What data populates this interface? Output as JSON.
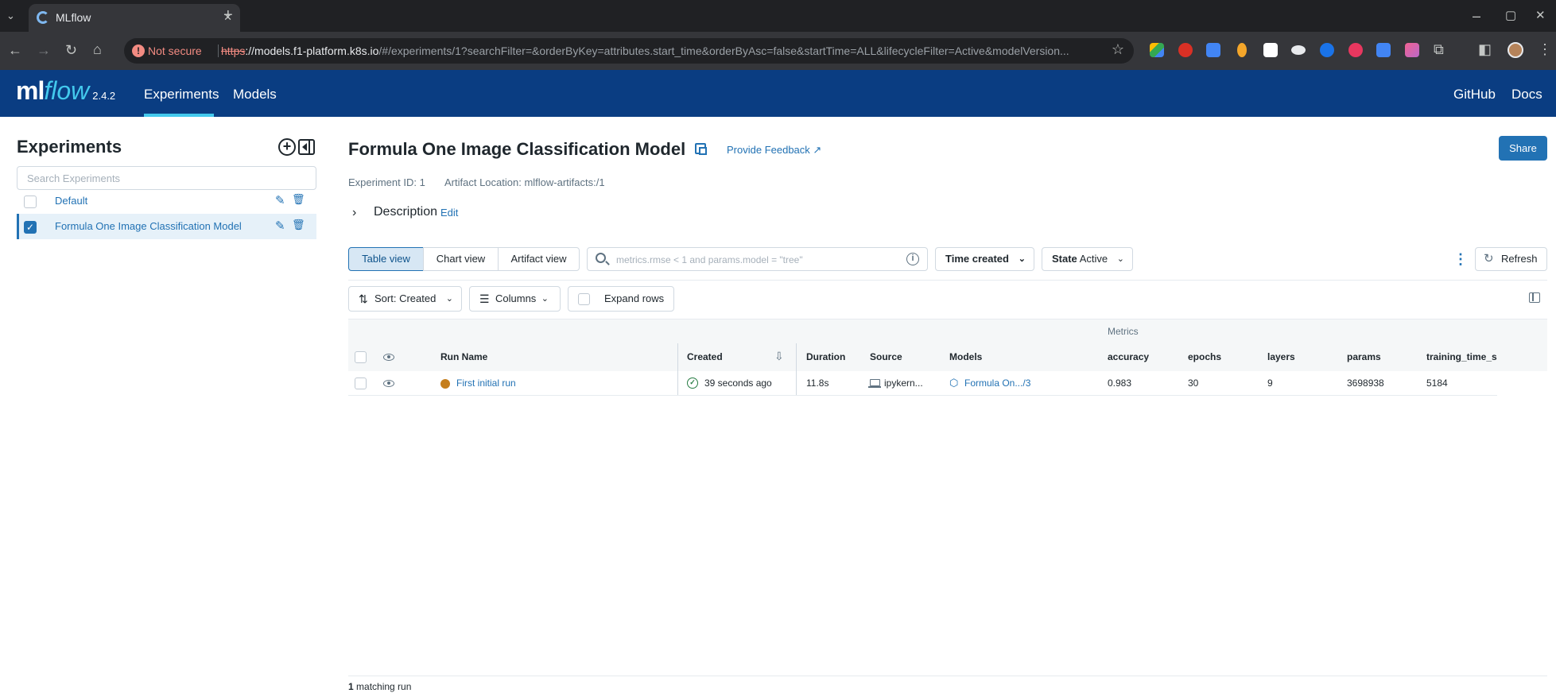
{
  "browser": {
    "tab_title": "MLflow",
    "tab_close": "✕",
    "new_tab": "+",
    "security_label": "Not secure",
    "url_scheme": "https",
    "url_host": "://models.f1-platform.k8s.io",
    "url_rest": "/#/experiments/1?searchFilter=&orderByKey=attributes.start_time&orderByAsc=false&startTime=ALL&lifecycleFilter=Active&modelVersion..."
  },
  "header": {
    "logo_ml": "ml",
    "logo_flow": "flow",
    "version": "2.4.2",
    "nav": [
      "Experiments",
      "Models"
    ],
    "right_links": [
      "GitHub",
      "Docs"
    ]
  },
  "sidebar": {
    "title": "Experiments",
    "search_placeholder": "Search Experiments",
    "experiments": [
      {
        "name": "Default",
        "selected": false
      },
      {
        "name": "Formula One Image Classification Model",
        "selected": true
      }
    ]
  },
  "main": {
    "title": "Formula One Image Classification Model",
    "feedback": "Provide Feedback",
    "share": "Share",
    "experiment_id": "Experiment ID: 1",
    "artifact_location": "Artifact Location: mlflow-artifacts:/1",
    "description_label": "Description",
    "description_edit": "Edit",
    "views": [
      "Table view",
      "Chart view",
      "Artifact view"
    ],
    "search_placeholder": "metrics.rmse < 1 and params.model = \"tree\"",
    "time_filter": "Time created",
    "state_label": "State",
    "state_value": "Active",
    "refresh": "Refresh",
    "sort_label": "Sort: Created",
    "columns_label": "Columns",
    "expand_rows": "Expand rows"
  },
  "table": {
    "group_header": "Metrics",
    "columns": [
      "Run Name",
      "Created",
      "Duration",
      "Source",
      "Models",
      "accuracy",
      "epochs",
      "layers",
      "params",
      "training_time_s"
    ],
    "rows": [
      {
        "run_name": "First initial run",
        "created": "39 seconds ago",
        "duration": "11.8s",
        "source": "ipykern...",
        "models": "Formula On.../3",
        "accuracy": "0.983",
        "epochs": "30",
        "layers": "9",
        "params": "3698938",
        "training_time_s": "5184"
      }
    ]
  },
  "footer": {
    "count": "1",
    "label": " matching run"
  },
  "colors": {
    "header_bg": "#0a3d82",
    "accent": "#43c9ed",
    "link": "#2272b4",
    "run_color": "#c57e1d",
    "success": "#277c43"
  }
}
